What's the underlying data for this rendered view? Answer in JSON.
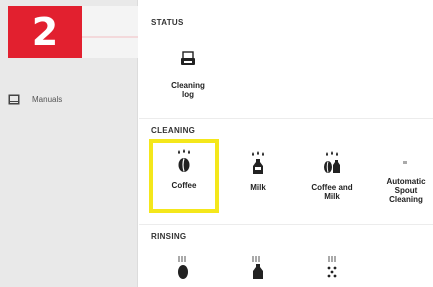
{
  "step_badge": "2",
  "sidebar": {
    "items": [
      {
        "label": "Manuals",
        "icon": "book-icon"
      }
    ]
  },
  "sections": {
    "status": {
      "title": "STATUS",
      "tiles": [
        {
          "label_line1": "Cleaning",
          "label_line2": "log",
          "icon": "printer-log-icon"
        }
      ]
    },
    "cleaning": {
      "title": "CLEANING",
      "tiles": [
        {
          "label_line1": "Coffee",
          "label_line2": "",
          "icon": "coffee-bean-drops-icon",
          "selected": true
        },
        {
          "label_line1": "Milk",
          "label_line2": "",
          "icon": "milk-bottle-drops-icon"
        },
        {
          "label_line1": "Coffee and",
          "label_line2": "Milk",
          "icon": "coffee-milk-drops-icon"
        },
        {
          "label_line1": "Automatic",
          "label_line2": "Spout",
          "label_line3": "Cleaning",
          "icon": "spout-dot-icon"
        }
      ]
    },
    "rinsing": {
      "title": "RINSING",
      "tiles": [
        {
          "icon": "coffee-rinse-icon"
        },
        {
          "icon": "milk-rinse-icon"
        },
        {
          "icon": "spout-rinse-icon"
        }
      ]
    }
  },
  "colors": {
    "badge": "#e2202f",
    "highlight": "#f4e71b",
    "sidebar_bg": "#e9e9e9"
  }
}
